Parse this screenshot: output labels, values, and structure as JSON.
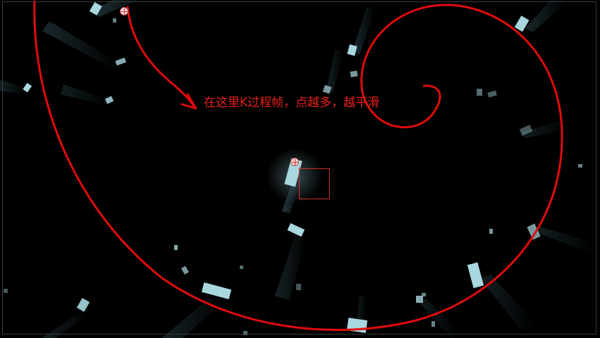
{
  "viewer": {
    "annotation": "在这里K过程帧，点越多，越平滑",
    "colors": {
      "background": "#000000",
      "annotation": "#e8201a",
      "path_stroke": "#e00c0c",
      "particle": "#a9d7e0",
      "glow": "#6fb6c8"
    }
  }
}
